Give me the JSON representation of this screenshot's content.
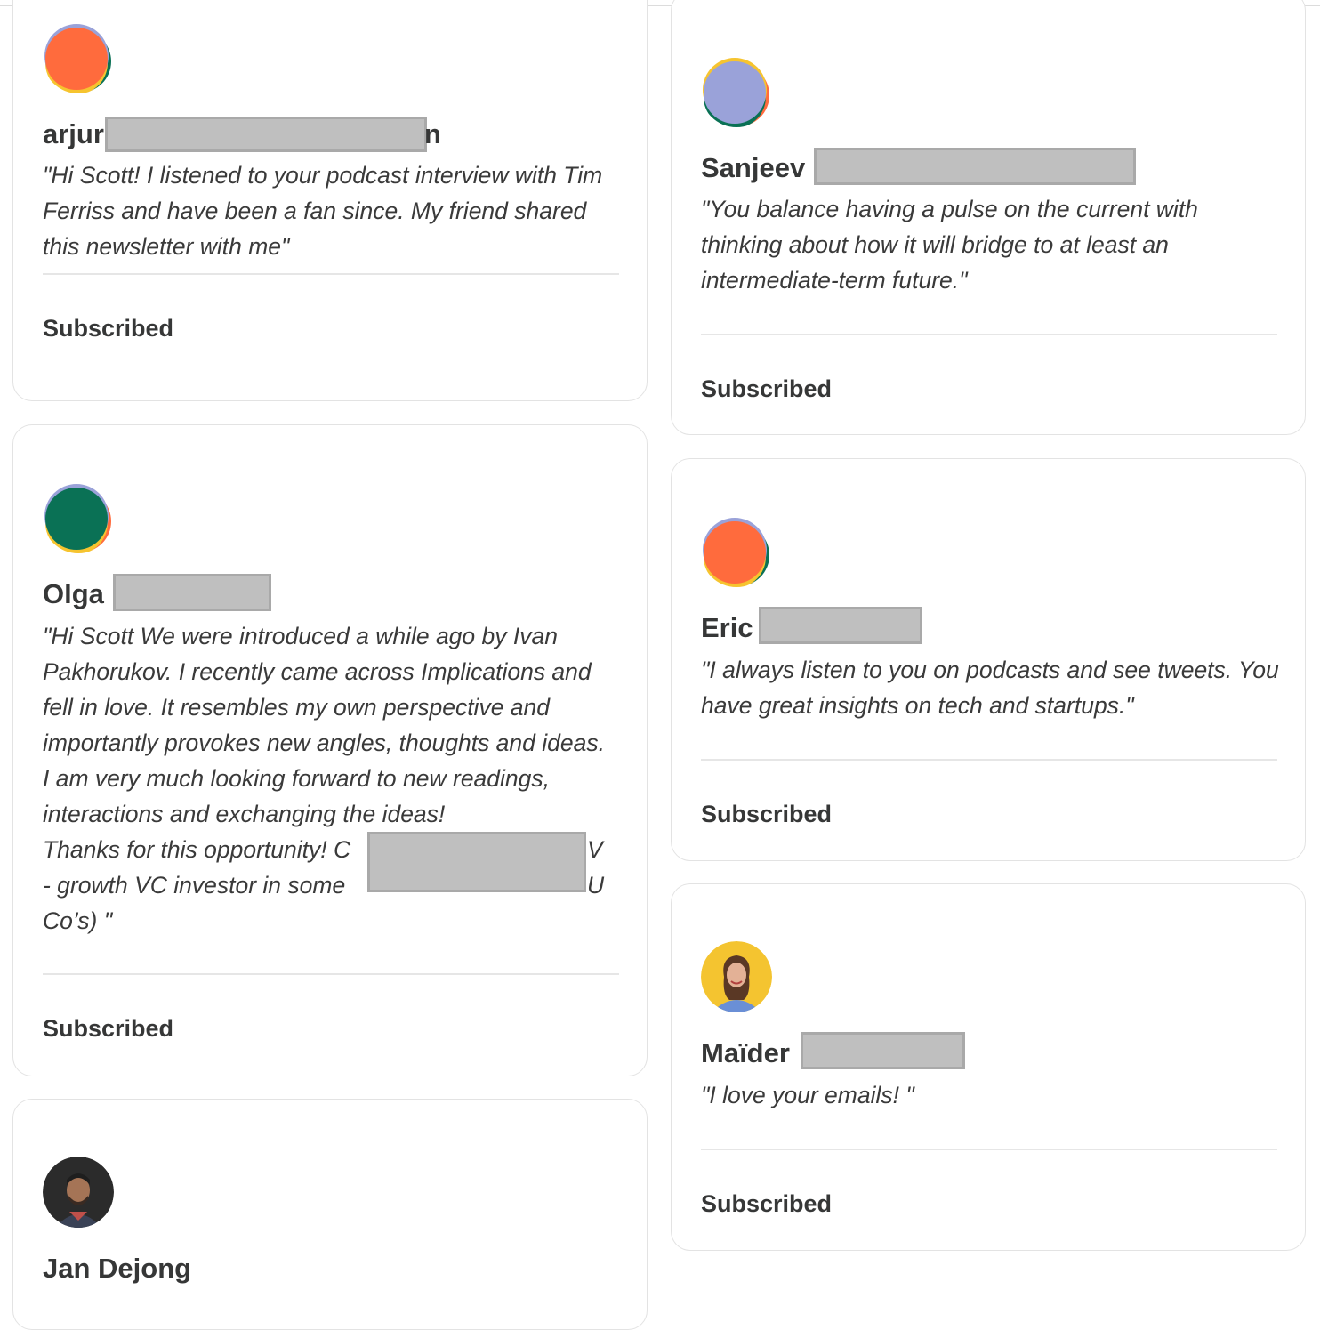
{
  "cards": {
    "arjun": {
      "name_visible": "arjur",
      "name_tail": "n",
      "quote": "\"Hi Scott! I listened to your podcast interview with Tim Ferriss and have been a fan since. My friend shared this newsletter with me\"",
      "status": "Subscribed"
    },
    "olga": {
      "name_visible": "Olga",
      "quote_part1": "\"Hi Scott We were introduced a while ago by Ivan Pakhorukov. I recently came across Implications and fell in love. It resembles my own perspective and importantly provokes new angles, thoughts and ideas. I am very much looking forward to new readings, interactions and exchanging the ideas!",
      "quote_line_a": "Thanks for this opportunity! C",
      "quote_line_a_tail": "V",
      "quote_line_b": "- growth VC investor in some",
      "quote_line_b_tail": "U",
      "quote_line_c": "Co’s) \"",
      "status": "Subscribed"
    },
    "jan": {
      "name_visible": "Jan Dejong"
    },
    "sanjeev": {
      "name_visible": "Sanjeev",
      "quote": "\"You balance having a pulse on the current with thinking about how it will bridge to at least an intermediate-term future.\"",
      "status": "Subscribed"
    },
    "eric": {
      "name_visible": "Eric",
      "quote": "\"I always listen to you on podcasts and see tweets. You have great insights on tech and startups.\"",
      "status": "Subscribed"
    },
    "maider": {
      "name_visible": "Maïder",
      "quote": "\"I love your emails! \"",
      "status": "Subscribed"
    }
  },
  "colors": {
    "orange": "#ff6b3d",
    "green": "#0a7155",
    "yellow": "#f6c42f",
    "lavender": "#9aa2d9",
    "border": "#e3e3e3"
  }
}
